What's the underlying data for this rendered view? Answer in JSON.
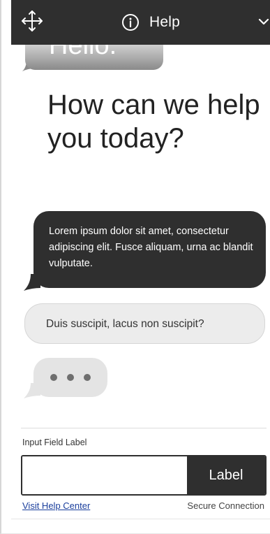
{
  "header": {
    "title": "Help",
    "move_icon": "move-arrows-icon",
    "info_icon": "info-circle-icon",
    "collapse_icon": "chevron-down-icon",
    "background": "#2f2f2f"
  },
  "chat": {
    "greeting": "Hello.",
    "headline": "How can we help you today?",
    "messages": [
      {
        "type": "agent",
        "text": "Lorem ipsum dolor sit amet, consectetur adipiscing elit. Fusce aliquam, urna ac blandit vulputate."
      },
      {
        "type": "suggestion",
        "text": "Duis suscipit, lacus non suscipit?"
      },
      {
        "type": "typing",
        "text": ""
      }
    ]
  },
  "input": {
    "label": "Input Field Label",
    "value": "",
    "placeholder": "",
    "button_label": "Label"
  },
  "footer": {
    "link_text": "Visit Help Center",
    "secure_text": "Secure Connection"
  },
  "colors": {
    "dark": "#2f2f2f",
    "light_bubble": "#ececec",
    "link": "#1a3e9c"
  }
}
